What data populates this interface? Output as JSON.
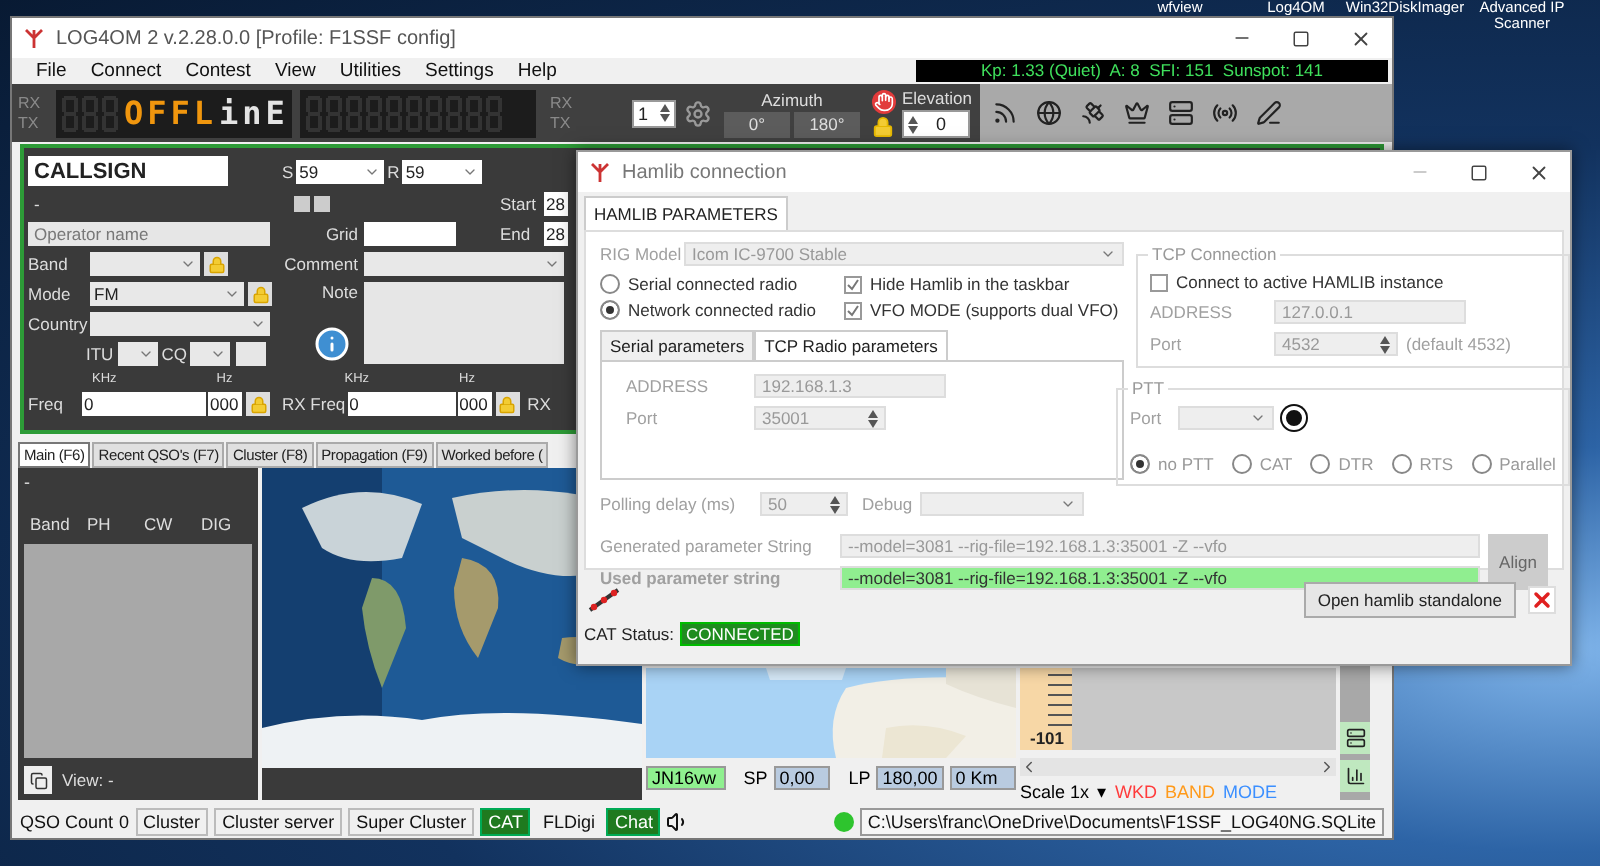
{
  "desktop_icons": [
    {
      "label": "wfview"
    },
    {
      "label": "Log4OM"
    },
    {
      "label": "Win32DiskImager"
    },
    {
      "label": "Advanced IP Scanner"
    }
  ],
  "main_window": {
    "title": "LOG4OM 2 v.2.28.0.0 [Profile: F1SSF config]",
    "menu": [
      "File",
      "Connect",
      "Contest",
      "View",
      "Utilities",
      "Settings",
      "Help"
    ],
    "space_weather": "Kp: 1.33 (Quiet)  A: 8  SFI: 151  Sunspot: 141",
    "display": {
      "rx": "RX",
      "tx": "TX",
      "lcd": [
        {
          "text": "OFFL",
          "color": "#f0960e"
        },
        {
          "text": "inE",
          "color": "#e4e4e4"
        }
      ],
      "rx2": "RX",
      "tx2": "TX",
      "spinner": "1",
      "azimuth_label": "Azimuth",
      "azimuth_values": [
        "0°",
        "180°"
      ],
      "elevation_label": "Elevation",
      "elevation_value": "0"
    },
    "qso": {
      "callsign": "CALLSIGN",
      "rst_sent": {
        "label": "S",
        "value": "59"
      },
      "rst_rcvd": {
        "label": "R",
        "value": "59"
      },
      "name_line": "-",
      "start": {
        "label": "Start",
        "value": "28"
      },
      "end": {
        "label": "End",
        "value": "28"
      },
      "operator": {
        "placeholder": "Operator name"
      },
      "grid_label": "Grid",
      "band_label": "Band",
      "comment_label": "Comment",
      "mode": {
        "label": "Mode",
        "value": "FM"
      },
      "note_label": "Note",
      "country_label": "Country",
      "itu_label": "ITU",
      "cq_label": "CQ",
      "freq": {
        "label": "Freq",
        "khz": "KHz",
        "hz": "Hz",
        "value": "0",
        "hz_value": "000"
      },
      "rx_freq": {
        "label": "RX Freq",
        "khz": "KHz",
        "hz": "Hz",
        "value": "0",
        "hz_value": "000"
      },
      "rx_cut": "RX"
    },
    "tabs": [
      {
        "label": "Main (F6)",
        "selected": true
      },
      {
        "label": "Recent QSO's (F7)",
        "selected": false
      },
      {
        "label": "Cluster (F8)",
        "selected": false
      },
      {
        "label": "Propagation (F9)",
        "selected": false
      },
      {
        "label": "Worked before (",
        "selected": false
      }
    ],
    "band_table": {
      "top_line": "-",
      "columns": [
        "Band",
        "PH",
        "CW",
        "DIG"
      ]
    },
    "view_label": "View: -",
    "locator": "JN16vw",
    "short_path": {
      "label": "SP",
      "value": "0,00"
    },
    "long_path": {
      "label": "LP",
      "value": "180,00"
    },
    "distance": "0 Km",
    "ruler_label": "-101",
    "scale": "Scale 1x",
    "scale_caret": "▾",
    "legend": [
      {
        "label": "WKD",
        "color": "#ff3b3b"
      },
      {
        "label": "BAND",
        "color": "#ff9a1a"
      },
      {
        "label": "MODE",
        "color": "#3b8fff"
      }
    ],
    "status_bar": {
      "qso_count_label": "QSO Count",
      "qso_count": "0",
      "items": [
        {
          "label": "Cluster",
          "kind": "button",
          "active": false
        },
        {
          "label": "Cluster server",
          "kind": "button",
          "active": false
        },
        {
          "label": "Super Cluster",
          "kind": "button",
          "active": false
        },
        {
          "label": "CAT",
          "kind": "button",
          "active": true
        },
        {
          "label": "FLDigi",
          "kind": "plain",
          "active": false
        },
        {
          "label": "Chat",
          "kind": "button",
          "active": true
        }
      ],
      "db_connected": true,
      "db_path": "C:\\Users\\franc\\OneDrive\\Documents\\F1SSF_LOG40NG.SQLite"
    }
  },
  "dialog": {
    "title": "Hamlib connection",
    "tabs": [
      {
        "label": "HAMLIB PARAMETERS",
        "selected": true
      }
    ],
    "rig_model": {
      "label": "RIG Model",
      "value": "Icom IC-9700 Stable"
    },
    "connection": [
      {
        "label": "Serial connected radio",
        "selected": false
      },
      {
        "label": "Network connected radio",
        "selected": true
      }
    ],
    "options": [
      {
        "label": "Hide Hamlib in the taskbar",
        "checked": true
      },
      {
        "label": "VFO MODE (supports dual VFO)",
        "checked": true
      }
    ],
    "param_tabs": [
      {
        "label": "Serial parameters",
        "selected": false
      },
      {
        "label": "TCP Radio parameters",
        "selected": true
      }
    ],
    "radio_address": {
      "label": "ADDRESS",
      "value": "192.168.1.3"
    },
    "radio_port": {
      "label": "Port",
      "value": "35001"
    },
    "tcp": {
      "title": "TCP Connection",
      "connect": {
        "label": "Connect to active HAMLIB instance",
        "checked": false
      },
      "address": {
        "label": "ADDRESS",
        "value": "127.0.0.1"
      },
      "port": {
        "label": "Port",
        "value": "4532"
      },
      "port_hint": "(default 4532)"
    },
    "ptt": {
      "title": "PTT",
      "port_label": "Port",
      "options": [
        {
          "label": "no PTT",
          "selected": true
        },
        {
          "label": "CAT",
          "selected": false
        },
        {
          "label": "DTR",
          "selected": false
        },
        {
          "label": "RTS",
          "selected": false
        },
        {
          "label": "Parallel",
          "selected": false
        }
      ]
    },
    "polling": {
      "label": "Polling delay (ms)",
      "value": "50"
    },
    "debug_label": "Debug",
    "generated": {
      "label": "Generated parameter String",
      "value": "--model=3081 --rig-file=192.168.1.3:35001 -Z --vfo"
    },
    "used": {
      "label": "Used parameter string",
      "value": "--model=3081 --rig-file=192.168.1.3:35001 -Z --vfo"
    },
    "align": "Align",
    "standalone": "Open hamlib standalone",
    "cat_status": {
      "label": "CAT Status:",
      "value": "CONNECTED"
    }
  }
}
